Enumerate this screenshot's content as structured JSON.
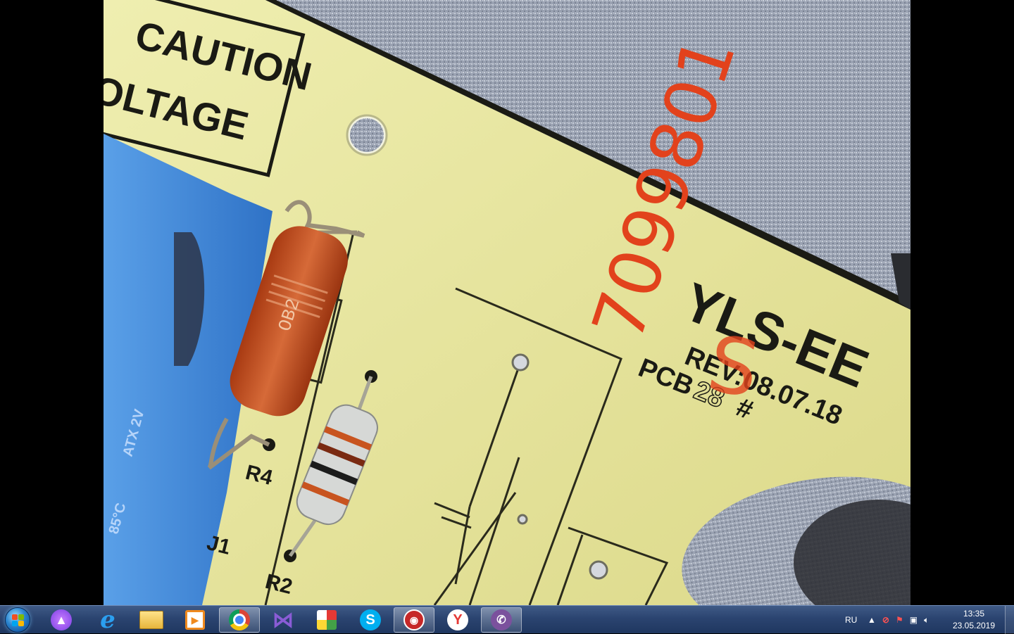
{
  "photo": {
    "board_label": "YLS-EE",
    "revision": "REV:08.07.18",
    "pcb_label": "PCB",
    "pcb_number": "28",
    "caution_line1": "CAUTION",
    "caution_line2": "OLTAGE",
    "handwritten_serial": "7099801",
    "handwritten_mark": "S",
    "label_r4": "R4",
    "label_j1": "J1",
    "label_r2": "R2",
    "resistor_marking": "OB2"
  },
  "taskbar": {
    "start_icon": "windows-orb-icon",
    "apps": [
      {
        "name": "alice-assistant",
        "icon": "alice-icon",
        "active": false
      },
      {
        "name": "internet-explorer",
        "icon": "ie-icon",
        "active": false
      },
      {
        "name": "file-explorer",
        "icon": "folder-icon",
        "active": false
      },
      {
        "name": "media-player",
        "icon": "video-player-icon",
        "active": false
      },
      {
        "name": "google-chrome",
        "icon": "chrome-icon",
        "active": true
      },
      {
        "name": "visual-studio",
        "icon": "visual-studio-icon",
        "active": false
      },
      {
        "name": "anydesk-like",
        "icon": "colorful-app-icon",
        "active": false
      },
      {
        "name": "skype",
        "icon": "skype-icon",
        "active": false
      },
      {
        "name": "camera-app",
        "icon": "camera-app-icon",
        "active": true
      },
      {
        "name": "yandex-browser",
        "icon": "yandex-icon",
        "active": false
      },
      {
        "name": "viber",
        "icon": "viber-icon",
        "active": true
      }
    ],
    "language": "RU",
    "time": "13:35",
    "date": "23.05.2019"
  },
  "colors": {
    "pcb": "#e6e49a",
    "accent": "#2b4470",
    "handwriting": "#e2421c"
  }
}
